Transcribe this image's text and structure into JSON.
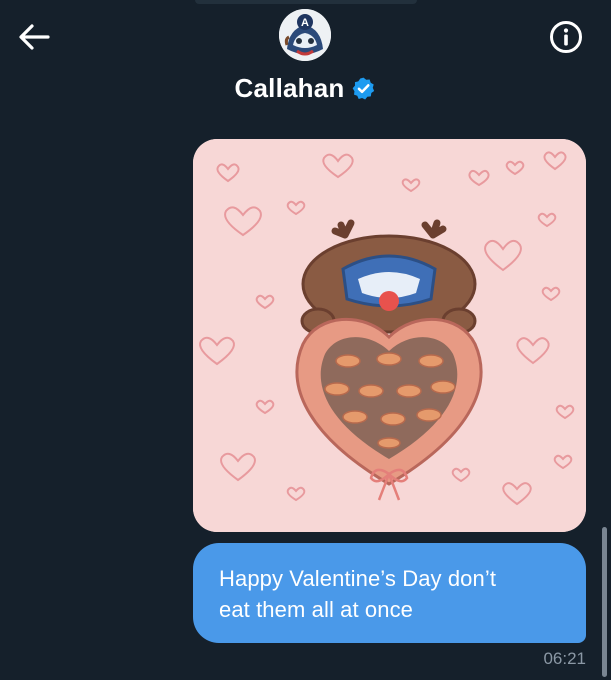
{
  "header": {
    "contact_name": "Callahan",
    "verified": true,
    "avatar_letter": "A",
    "back_icon": "arrow-left-icon",
    "info_icon": "info-circle-icon"
  },
  "conversation": {
    "image_message": {
      "description_icon": "valentine-chocolates-illustration"
    },
    "text_message": {
      "text": "Happy Valentine’s Day don’t eat them all at once",
      "line1": "Happy Valentine’s Day don’t",
      "line2": "eat them all at once"
    },
    "timestamp": "06:21"
  },
  "colors": {
    "background": "#15202b",
    "bubble": "#4a99e9",
    "verified_badge": "#1d9bf0",
    "image_background": "#f7d7d6",
    "timestamp": "#8b98a5"
  }
}
